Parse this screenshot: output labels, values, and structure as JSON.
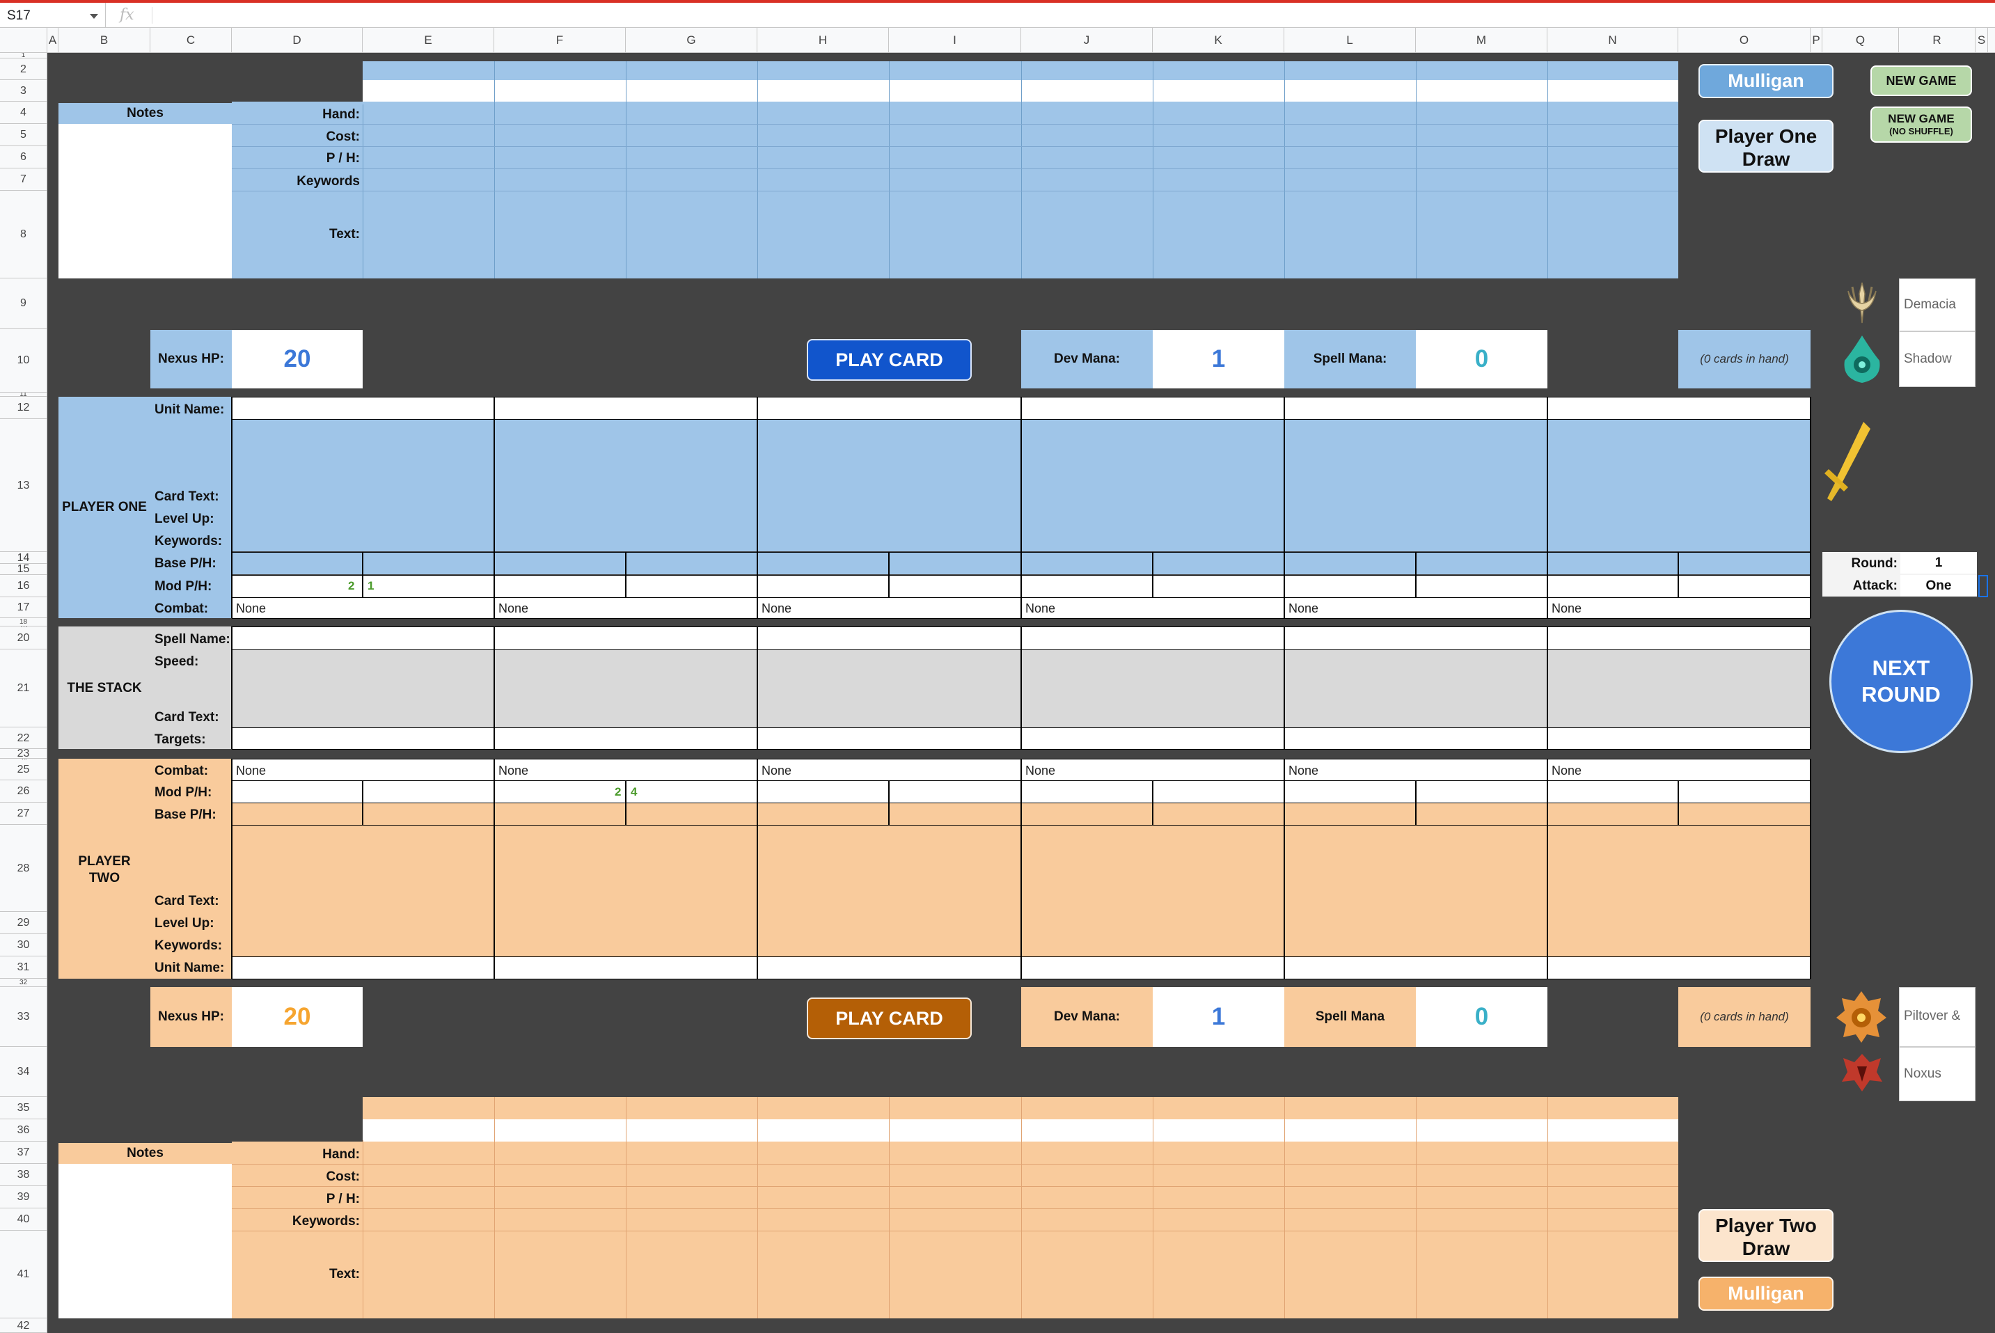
{
  "window": {
    "name_box": "S17",
    "fx": "fx"
  },
  "columns": [
    "A",
    "B",
    "C",
    "D",
    "E",
    "F",
    "G",
    "H",
    "I",
    "J",
    "K",
    "L",
    "M",
    "N",
    "O",
    "P",
    "Q",
    "R",
    "S"
  ],
  "rows": [
    "1",
    "2",
    "3",
    "4",
    "5",
    "6",
    "7",
    "8",
    "9",
    "10",
    "11",
    "12",
    "13",
    "14",
    "15",
    "16",
    "17",
    "18",
    "19",
    "20",
    "21",
    "22",
    "23",
    "24",
    "25",
    "26",
    "27",
    "28",
    "29",
    "30",
    "31",
    "32",
    "33",
    "34",
    "35",
    "36",
    "37",
    "38",
    "39",
    "40",
    "41",
    "42"
  ],
  "colors": {
    "blue": "#9fc5e8",
    "orange": "#f9cb9c",
    "gray": "#d9d9d9",
    "dark": "#434343",
    "play_blue": "#1155cc",
    "play_orange": "#b45f06",
    "next_round": "#3c78d8",
    "green_btn": "#b6d7a8"
  },
  "player_one_hand": {
    "notes_label": "Notes",
    "labels": [
      "Hand:",
      "Cost:",
      "P / H:",
      "Keywords",
      "Text:"
    ]
  },
  "player_two_hand": {
    "notes_label": "Notes",
    "labels": [
      "Hand:",
      "Cost:",
      "P / H:",
      "Keywords:",
      "Text:"
    ]
  },
  "buttons": {
    "mulligan_top": "Mulligan",
    "p1_draw": "Player One Draw",
    "new_game": "NEW GAME",
    "new_game_ns": "NEW GAME",
    "new_game_ns_sub": "(NO SHUFFLE)",
    "play_card": "PLAY CARD",
    "next_round": "NEXT ROUND",
    "p2_draw": "Player Two Draw",
    "mulligan_bottom": "Mulligan"
  },
  "player_one": {
    "nexus_label": "Nexus HP:",
    "nexus_hp": "20",
    "dev_mana_label": "Dev Mana:",
    "dev_mana": "1",
    "spell_mana_label": "Spell Mana:",
    "spell_mana": "0",
    "cards_in_hand": "(0 cards in hand)",
    "region1": "Demacia",
    "region2": "Shadow",
    "section_label": "PLAYER ONE",
    "row_labels": {
      "unit_name": "Unit Name:",
      "card_text": "Card Text:",
      "level_up": "Level Up:",
      "keywords": "Keywords:",
      "base_ph": "Base P/H:",
      "mod_ph": "Mod P/H:",
      "combat": "Combat:"
    },
    "mod_p": "2",
    "mod_h": "1",
    "combat": [
      "None",
      "None",
      "None",
      "None",
      "None",
      "None"
    ]
  },
  "stack": {
    "section_label": "THE STACK",
    "row_labels": {
      "spell_name": "Spell Name:",
      "speed": "Speed:",
      "card_text": "Card Text:",
      "targets": "Targets:"
    }
  },
  "player_two": {
    "nexus_label": "Nexus HP:",
    "nexus_hp": "20",
    "dev_mana_label": "Dev Mana:",
    "dev_mana": "1",
    "spell_mana_label": "Spell Mana",
    "spell_mana": "0",
    "cards_in_hand": "(0 cards in hand)",
    "region1": "Piltover &",
    "region2": "Noxus",
    "section_label": "PLAYER TWO",
    "row_labels": {
      "combat": "Combat:",
      "mod_ph": "Mod P/H:",
      "base_ph": "Base P/H:",
      "card_text": "Card Text:",
      "level_up": "Level Up:",
      "keywords": "Keywords:",
      "unit_name": "Unit Name:"
    },
    "mod_p": "2",
    "mod_h": "4",
    "combat": [
      "None",
      "None",
      "None",
      "None",
      "None",
      "None"
    ]
  },
  "round": {
    "round_label": "Round:",
    "round_value": "1",
    "attack_label": "Attack:",
    "attack_value": "One"
  },
  "icons": [
    "demacia-icon",
    "shadow-isles-icon",
    "attack-sword-icon",
    "piltover-icon",
    "noxus-icon"
  ]
}
